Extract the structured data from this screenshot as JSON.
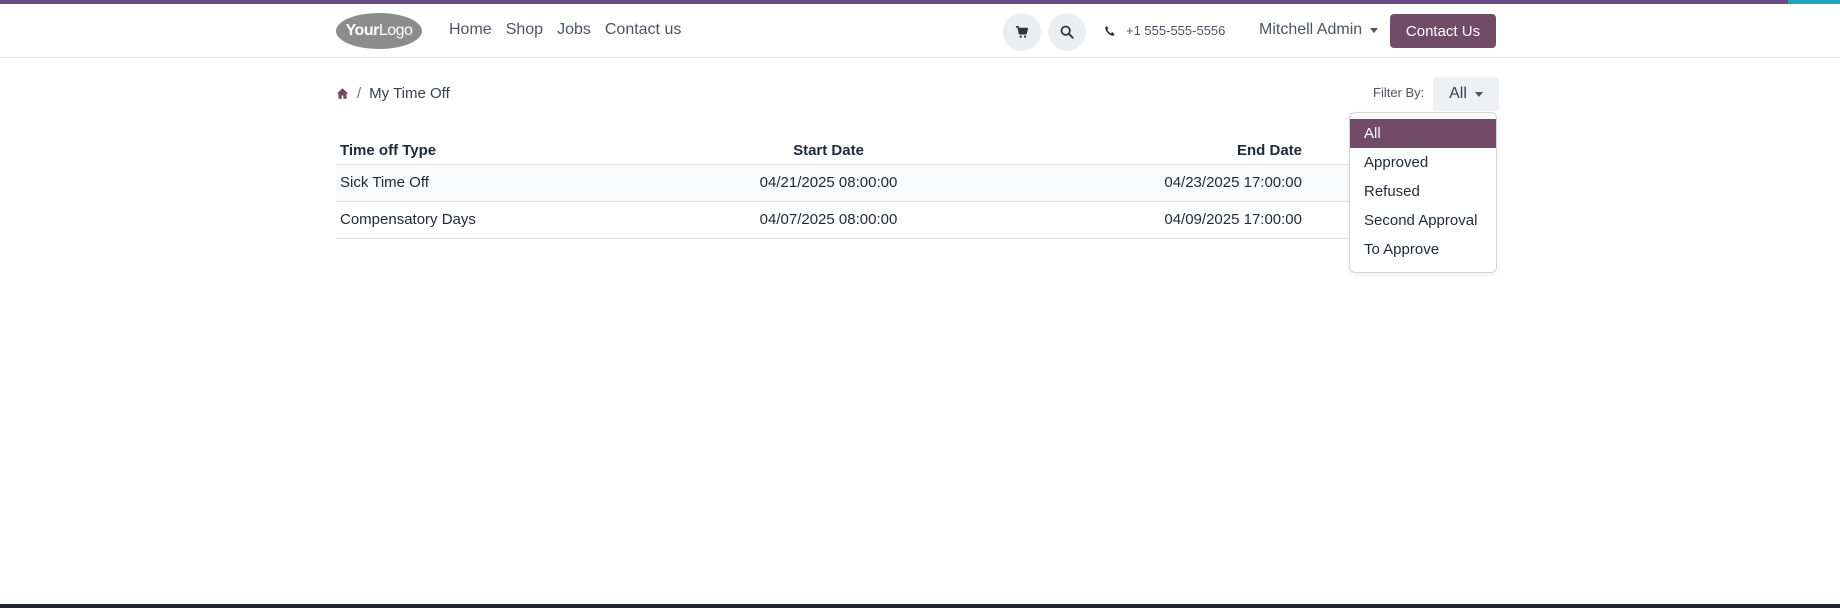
{
  "colors": {
    "accent": "#714b67",
    "topbar": "#6b4a8c",
    "topbar_right": "#1ea6b8"
  },
  "header": {
    "logo": {
      "bold": "Your",
      "thin": "Logo"
    },
    "nav": [
      "Home",
      "Shop",
      "Jobs",
      "Contact us"
    ],
    "phone": "+1 555-555-5556",
    "user": "Mitchell Admin",
    "cta": "Contact Us",
    "icons": {
      "cart": "cart-icon",
      "search": "search-icon",
      "phone": "phone-icon"
    }
  },
  "breadcrumb": {
    "home_icon": "home-icon",
    "separator": "/",
    "current": "My Time Off"
  },
  "filter": {
    "label": "Filter By:",
    "selected": "All",
    "options": [
      "All",
      "Approved",
      "Refused",
      "Second Approval",
      "To Approve"
    ]
  },
  "table": {
    "headers": [
      "Time off Type",
      "Start Date",
      "End Date"
    ],
    "rows": [
      [
        "Sick Time Off",
        "04/21/2025 08:00:00",
        "04/23/2025 17:00:00"
      ],
      [
        "Compensatory Days",
        "04/07/2025 08:00:00",
        "04/09/2025 17:00:00"
      ]
    ]
  }
}
